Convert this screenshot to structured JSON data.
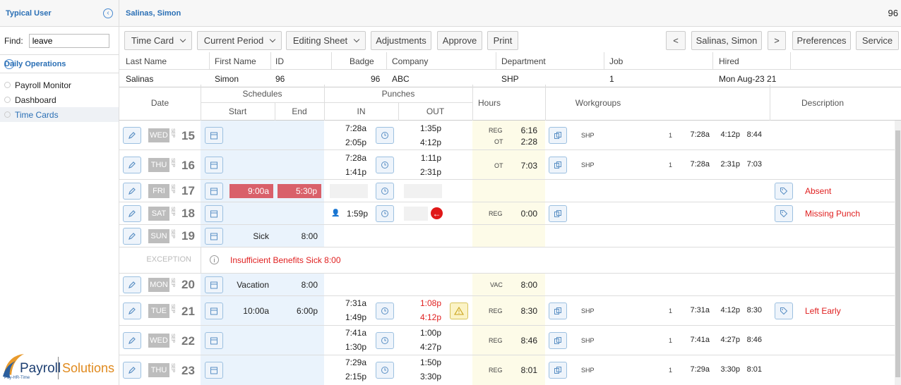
{
  "sidebar": {
    "title": "Typical User",
    "find_label": "Find:",
    "find_value": "leave",
    "section": "Daily Operations",
    "items": [
      {
        "label": "Payroll Monitor"
      },
      {
        "label": "Dashboard"
      },
      {
        "label": "Time Cards"
      }
    ]
  },
  "logo": {
    "text1": "Payroll",
    "text2": "Solutions",
    "tag": "Pay-HR-Time"
  },
  "topbar": {
    "employee": "Salinas, Simon",
    "number": "96"
  },
  "toolbar": {
    "time_card": "Time Card",
    "current_period": "Current Period",
    "editing_sheet": "Editing Sheet",
    "adjustments": "Adjustments",
    "approve": "Approve",
    "print": "Print",
    "prev": "<",
    "employee": "Salinas, Simon",
    "next": ">",
    "preferences": "Preferences",
    "service": "Service"
  },
  "info": {
    "headers": {
      "last": "Last Name",
      "first": "First Name",
      "id": "ID",
      "badge": "Badge",
      "company": "Company",
      "department": "Department",
      "job": "Job",
      "hired": "Hired"
    },
    "values": {
      "last": "Salinas",
      "first": "Simon",
      "id": "96",
      "badge": "96",
      "company": "ABC",
      "department": "SHP",
      "job": "1",
      "hired": "Mon Aug-23 21"
    }
  },
  "grid_header": {
    "date": "Date",
    "schedules": "Schedules",
    "start": "Start",
    "end": "End",
    "punches": "Punches",
    "in": "IN",
    "out": "OUT",
    "hours": "Hours",
    "workgroups": "Workgroups",
    "description": "Description"
  },
  "days": [
    {
      "dow": "WED",
      "mon": "SEP",
      "day": "15",
      "in1": "7:28a",
      "in2": "2:05p",
      "out1": "1:35p",
      "out2": "4:12p",
      "h1": "REG",
      "v1": "6:16",
      "h2": "OT",
      "v2": "2:28",
      "wg": "SHP",
      "job": "1",
      "w1": "7:28a",
      "w2": "4:12p",
      "w3": "8:44"
    },
    {
      "dow": "THU",
      "mon": "SEP",
      "day": "16",
      "in1": "7:28a",
      "in2": "1:41p",
      "out1": "1:11p",
      "out2": "2:31p",
      "h1": "OT",
      "v1": "7:03",
      "wg": "SHP",
      "job": "1",
      "w1": "7:28a",
      "w2": "2:31p",
      "w3": "7:03"
    },
    {
      "dow": "FRI",
      "mon": "SEP",
      "day": "17",
      "start": "9:00a",
      "end": "5:30p",
      "desc": "Absent"
    },
    {
      "dow": "SAT",
      "mon": "SEP",
      "day": "18",
      "in1": "1:59p",
      "h1": "REG",
      "v1": "0:00",
      "desc": "Missing Punch"
    },
    {
      "dow": "SUN",
      "mon": "SEP",
      "day": "19",
      "start": "Sick",
      "end": "8:00"
    },
    {
      "exception": "EXCEPTION",
      "message": "Insufficient Benefits Sick 8:00"
    },
    {
      "dow": "MON",
      "mon": "SEP",
      "day": "20",
      "start": "Vacation",
      "end": "8:00",
      "h1": "VAC",
      "v1": "8:00"
    },
    {
      "dow": "TUE",
      "mon": "SEP",
      "day": "21",
      "start": "10:00a",
      "end": "6:00p",
      "in1": "7:31a",
      "in2": "1:49p",
      "out1": "1:08p",
      "out2": "4:12p",
      "h1": "REG",
      "v1": "8:30",
      "wg": "SHP",
      "job": "1",
      "w1": "7:31a",
      "w2": "4:12p",
      "w3": "8:30",
      "desc": "Left Early"
    },
    {
      "dow": "WED",
      "mon": "SEP",
      "day": "22",
      "in1": "7:41a",
      "in2": "1:30p",
      "out1": "1:00p",
      "out2": "4:27p",
      "h1": "REG",
      "v1": "8:46",
      "wg": "SHP",
      "job": "1",
      "w1": "7:41a",
      "w2": "4:27p",
      "w3": "8:46"
    },
    {
      "dow": "THU",
      "mon": "SEP",
      "day": "23",
      "in1": "7:29a",
      "in2": "2:15p",
      "out1": "1:50p",
      "out2": "3:30p",
      "h1": "REG",
      "v1": "8:01",
      "wg": "SHP",
      "job": "1",
      "w1": "7:29a",
      "w2": "3:30p",
      "w3": "8:01"
    }
  ],
  "colors": {
    "accent": "#2a6fb5",
    "alert": "#e02020",
    "absent_bar": "#d9606a"
  }
}
